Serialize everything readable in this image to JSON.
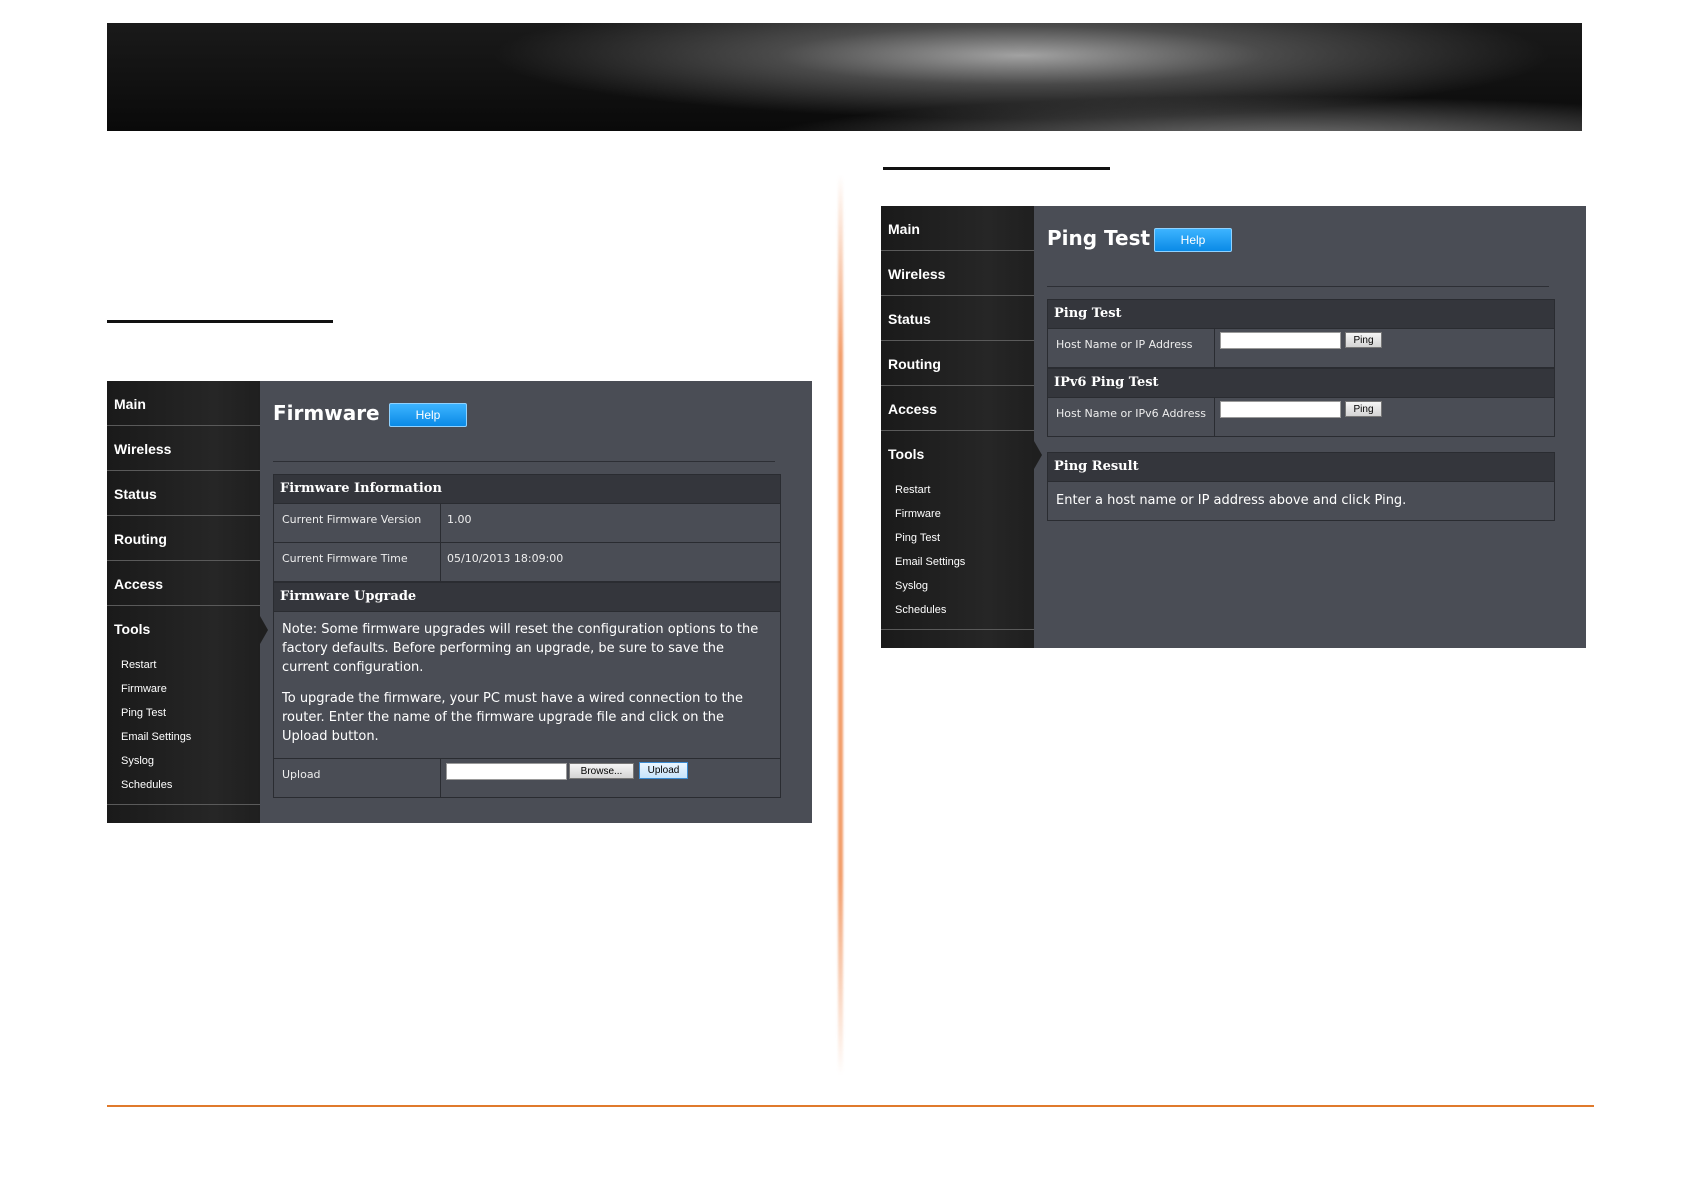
{
  "firmware_panel": {
    "nav": [
      "Main",
      "Wireless",
      "Status",
      "Routing",
      "Access",
      "Tools"
    ],
    "subnav": [
      "Restart",
      "Firmware",
      "Ping Test",
      "Email Settings",
      "Syslog",
      "Schedules"
    ],
    "title": "Firmware",
    "help": "Help",
    "info_header": "Firmware Information",
    "version_label": "Current Firmware Version",
    "version_value": "1.00",
    "time_label": "Current Firmware Time",
    "time_value": "05/10/2013 18:09:00",
    "upgrade_header": "Firmware Upgrade",
    "note1": "Note: Some firmware upgrades will reset the configuration options to the factory defaults. Before performing an upgrade, be sure to save the current configuration.",
    "note2": "To upgrade the firmware, your PC must have a wired connection to the router. Enter the name of the firmware upgrade file and click on the Upload button.",
    "upload_label": "Upload",
    "browse_button": "Browse...",
    "upload_button": "Upload"
  },
  "ping_panel": {
    "nav": [
      "Main",
      "Wireless",
      "Status",
      "Routing",
      "Access",
      "Tools"
    ],
    "subnav": [
      "Restart",
      "Firmware",
      "Ping Test",
      "Email Settings",
      "Syslog",
      "Schedules"
    ],
    "title": "Ping Test",
    "help": "Help",
    "ping_header": "Ping Test",
    "host_label": "Host Name or IP Address",
    "ping_button": "Ping",
    "ipv6_header": "IPv6 Ping Test",
    "host6_label": "Host Name or IPv6 Address",
    "ping6_button": "Ping",
    "result_header": "Ping Result",
    "result_text": "Enter a host name or IP address above and click Ping."
  },
  "colors": {
    "accent_orange": "#e07a2c",
    "help_blue": "#0a8ae6",
    "panel_bg": "#4a4d55"
  }
}
